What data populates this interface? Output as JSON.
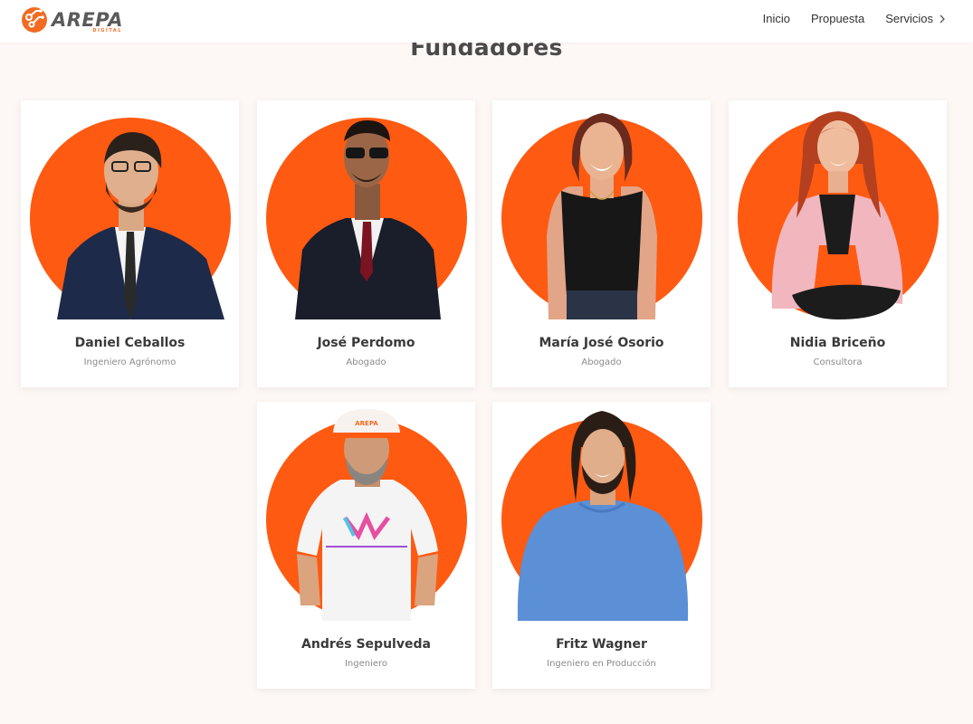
{
  "brand": {
    "name": "AREPA",
    "tagline": "DIGITAL",
    "accent": "#f26b21",
    "circle_color": "#ff5a12"
  },
  "nav": {
    "items": [
      "Inicio",
      "Propuesta",
      "Servicios"
    ],
    "servicios_icon": "chevron-right-icon"
  },
  "section": {
    "title": "Fundadores"
  },
  "founders": [
    {
      "name": "Daniel Ceballos",
      "role": "Ingeniero Agrónomo"
    },
    {
      "name": "José Perdomo",
      "role": "Abogado"
    },
    {
      "name": "María José Osorio",
      "role": "Abogado"
    },
    {
      "name": "Nidia Briceño",
      "role": "Consultora"
    },
    {
      "name": "Andrés Sepulveda",
      "role": "Ingeniero"
    },
    {
      "name": "Fritz Wagner",
      "role": "Ingeniero en Producción"
    }
  ]
}
